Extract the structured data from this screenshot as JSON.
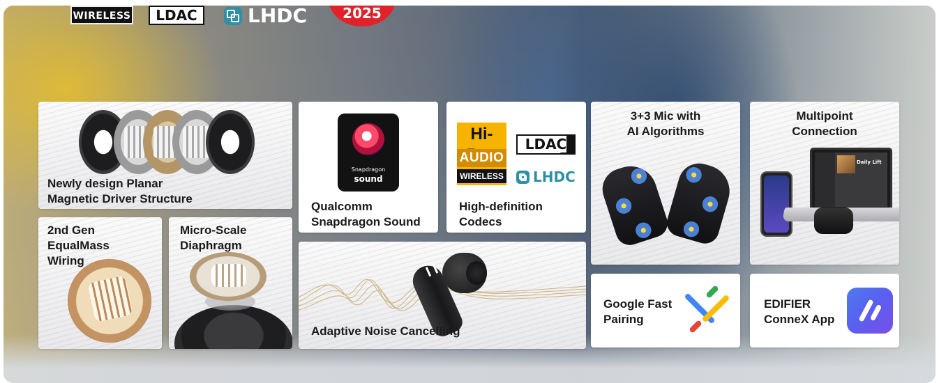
{
  "logos": {
    "wireless": "WIRELESS",
    "ldac": "LDAC",
    "lhdc": "LHDC",
    "year_badge": "2025"
  },
  "cards": {
    "planar_driver": {
      "label": "Newly design Planar\nMagnetic Driver Structure"
    },
    "snapdragon": {
      "label": "Qualcomm\nSnapdragon Sound",
      "logo_line1": "Snapdragon",
      "logo_line2": "sound"
    },
    "codecs": {
      "label": "High-definition\nCodecs",
      "hires_top": "Hi-Res",
      "hires_mid": "AUDIO",
      "hires_bottom": "WIRELESS",
      "ldac": "LDAC",
      "lhdc": "LHDC"
    },
    "mics": {
      "label": "3+3 Mic with\nAI Algorithms"
    },
    "multipoint": {
      "label": "Multipoint\nConnection",
      "laptop_track": "Daily Lift"
    },
    "equalmass": {
      "label": "2nd Gen\nEqualMass\nWiring"
    },
    "diaphragm": {
      "label": "Micro-Scale\nDiaphragm"
    },
    "anc": {
      "label": "Adaptive Noise Cancelling"
    },
    "fast_pair": {
      "label": "Google Fast\nPairing"
    },
    "connex": {
      "label": "EDIFIER\nConneX App"
    }
  },
  "colors": {
    "lhdc_teal": "#2f8fa7",
    "hires_gold": "#f6b400",
    "badge_red": "#e0232a",
    "google_blue": "#4285f4",
    "google_red": "#ea4335",
    "google_yellow": "#fbbc05",
    "google_green": "#34a853",
    "connex_blue": "#5a5ff0"
  },
  "icons": [
    "lhdc-icon",
    "snapdragon-icon",
    "google-fast-pair-icon",
    "edifier-connex-icon"
  ]
}
